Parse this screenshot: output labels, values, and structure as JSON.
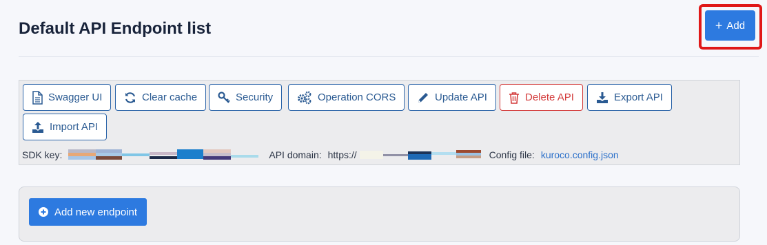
{
  "header": {
    "title": "Default API Endpoint list",
    "add_button": {
      "icon": "plus-icon",
      "label": "Add"
    }
  },
  "toolbar": {
    "buttons": [
      {
        "icon": "document-icon",
        "label": "Swagger UI"
      },
      {
        "icon": "refresh-icon",
        "label": "Clear cache"
      },
      {
        "icon": "key-icon",
        "label": "Security"
      },
      {
        "icon": "gears-icon",
        "label": "Operation CORS"
      },
      {
        "icon": "pencil-icon",
        "label": "Update API"
      },
      {
        "icon": "trash-icon",
        "label": "Delete API",
        "color": "#d33a3a"
      },
      {
        "icon": "download-icon",
        "label": "Export API"
      },
      {
        "icon": "upload-icon",
        "label": "Import API"
      }
    ]
  },
  "meta": {
    "sdk_key_label": "SDK key:",
    "api_domain_label": "API domain:",
    "api_domain_value": "https://",
    "config_file_label": "Config file:",
    "config_file_value": "kuroco.config.json"
  },
  "endpoints": {
    "add_endpoint_button": {
      "icon": "plus-circle-icon",
      "label": "Add new endpoint"
    }
  },
  "colors": {
    "primary": "#2d7ae0",
    "outline": "#2a63a8",
    "danger": "#d33a3a",
    "highlight": "#e01818"
  }
}
